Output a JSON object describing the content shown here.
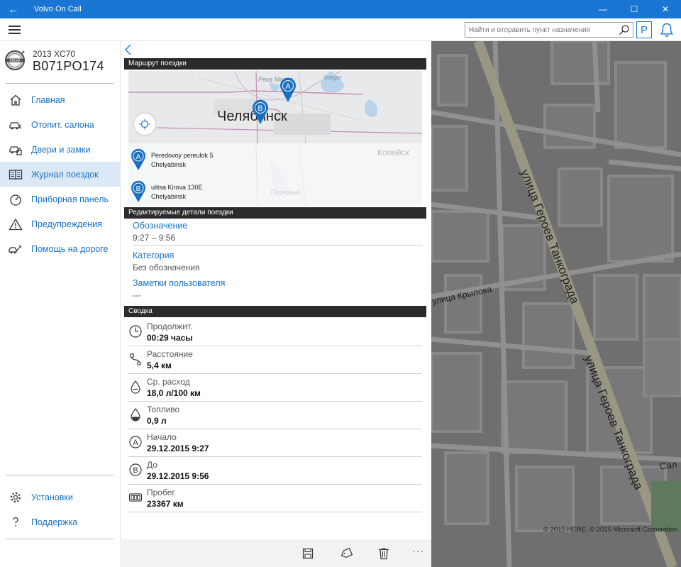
{
  "window": {
    "title": "Volvo On Call",
    "back_glyph": "←",
    "minimize_glyph": "—",
    "maximize_glyph": "☐",
    "close_glyph": "✕"
  },
  "appbar": {
    "search_placeholder": "Найти и отправить пункт назначения",
    "parking_label": "P"
  },
  "car": {
    "model": "2013 XC70",
    "plate": "B071PO174"
  },
  "nav": {
    "items": [
      {
        "label": "Главная",
        "icon": "home-icon"
      },
      {
        "label": "Отопит. салона",
        "icon": "car-heater-icon"
      },
      {
        "label": "Двери и замки",
        "icon": "car-lock-icon"
      },
      {
        "label": "Журнал поездок",
        "icon": "journal-icon",
        "active": true
      },
      {
        "label": "Приборная панель",
        "icon": "dashboard-gauge-icon"
      },
      {
        "label": "Предупреждения",
        "icon": "warning-icon"
      },
      {
        "label": "Помощь на дороге",
        "icon": "roadside-assistance-icon"
      }
    ],
    "bottom": [
      {
        "label": "Установки",
        "icon": "gear-icon"
      },
      {
        "label": "Поддержка",
        "icon": "help-icon"
      }
    ]
  },
  "route": {
    "header": "Маршрут поездки",
    "map": {
      "city": "Челябинск",
      "river": "Река Миасс",
      "lake": "озеро",
      "near_city": "Копейск",
      "pin_a": "A",
      "pin_b": "B",
      "faded_label": "Сосновый"
    },
    "start": {
      "letter": "A",
      "line1": "Peredovoy pereulok 5",
      "line2": "Chelyabinsk"
    },
    "end": {
      "letter": "B",
      "line1": "ulitsa Kirova 130E",
      "line2": "Chelyabinsk"
    }
  },
  "editable": {
    "header": "Редактируемые детали поездки",
    "designation_label": "Обозначение",
    "designation_value": "9:27 – 9:56",
    "category_label": "Категория",
    "category_value": "Без обозначения",
    "notes_label": "Заметки пользователя",
    "notes_value": "---"
  },
  "summary": {
    "header": "Сводка",
    "rows": [
      {
        "label": "Продолжит.",
        "value": "00:29 часы",
        "icon": "clock-icon"
      },
      {
        "label": "Расстояние",
        "value": "5,4 км",
        "icon": "route-distance-icon"
      },
      {
        "label": "Ср. расход",
        "value": "18,0 л/100 км",
        "icon": "fuel-drop-icon"
      },
      {
        "label": "Топливо",
        "value": "0,9 л",
        "icon": "fuel-drop-icon"
      },
      {
        "label": "Начало",
        "value": "29.12.2015 9:27",
        "icon": "start-point-icon"
      },
      {
        "label": "До",
        "value": "29.12.2015 9:56",
        "icon": "end-point-icon"
      },
      {
        "label": "Пробег",
        "value": "23367 км",
        "icon": "odometer-icon"
      }
    ]
  },
  "commandbar": {
    "more": "···"
  },
  "bigmap": {
    "street1": "улица Героев Танкограда",
    "street2": "улица Героев Танкограда",
    "street3": "улица Крылова",
    "street4": "Сал",
    "copyright": "© 2015 HERE, © 2015 Microsoft Corporation"
  },
  "colors": {
    "accent": "#1976d2",
    "link": "#1a72c4",
    "active_nav": "#dbe8f6",
    "header_bar": "#2b2b2b"
  }
}
